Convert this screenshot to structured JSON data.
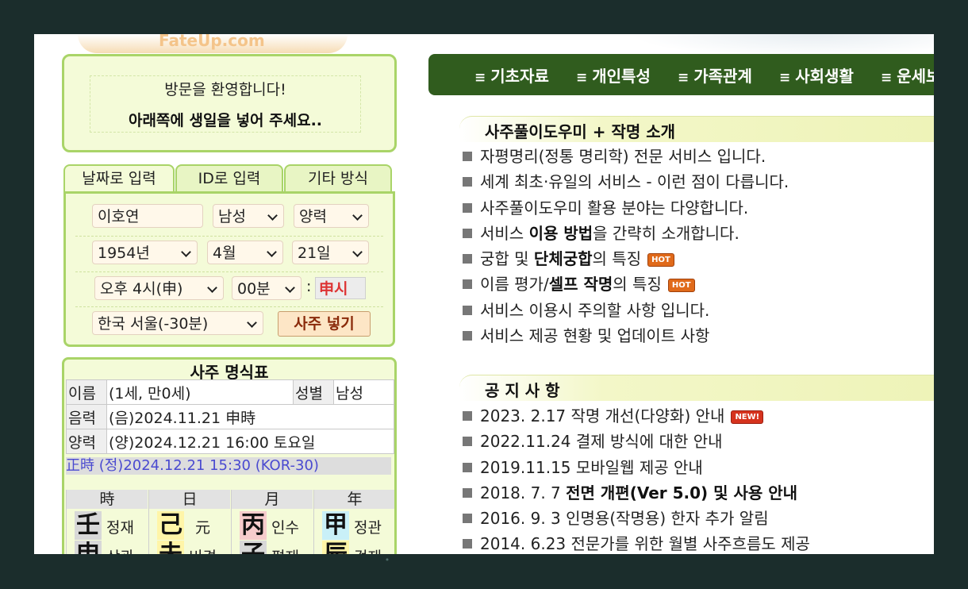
{
  "logo": {
    "text": "FateUp.com"
  },
  "welcome": {
    "line1": "방문을 환영합니다!",
    "line2": "아래쪽에 생일을 넣어 주세요.."
  },
  "tabs": [
    {
      "label": "날짜로 입력",
      "active": true
    },
    {
      "label": "ID로 입력",
      "active": false
    },
    {
      "label": "기타 방식",
      "active": false
    }
  ],
  "form": {
    "name": "이호연",
    "gender": "남성",
    "calendar": "양력",
    "year": "1954년",
    "month": "4월",
    "day": "21일",
    "hour": "오후 4시(申)",
    "minute": "00분",
    "colon": ":",
    "sisi": "申시",
    "region": "한국 서울(-30분)",
    "submit_label": "사주 넣기"
  },
  "saju": {
    "title": "사주 명식표",
    "name_label": "이름",
    "name_value": "(1세, 만0세)",
    "gender_label": "성별",
    "gender_value": "남성",
    "lunar_label": "음력",
    "lunar_value": "(음)2024.11.21 申時",
    "solar_label": "양력",
    "solar_value": "(양)2024.12.21 16:00 토요일",
    "true_time": "正時 (정)2024.12.21 15:30 (KOR-30)",
    "pillars": [
      {
        "head": "時",
        "stem": "壬",
        "stem_label": "정재",
        "branch": "申",
        "branch_label": "상관",
        "stem_color": "#d8d8d8",
        "branch_color": "#d8d8d8"
      },
      {
        "head": "日",
        "stem": "己",
        "stem_label": "元",
        "branch": "未",
        "branch_label": "비견",
        "stem_color": "#fff5a8",
        "branch_color": "#fff5a8"
      },
      {
        "head": "月",
        "stem": "丙",
        "stem_label": "인수",
        "branch": "子",
        "branch_label": "편재",
        "stem_color": "#f7cccc",
        "branch_color": "#d8d8d8"
      },
      {
        "head": "年",
        "stem": "甲",
        "stem_label": "정관",
        "branch": "辰",
        "branch_label": "겁재",
        "stem_color": "#c9f0f8",
        "branch_color": "#fff5a8"
      }
    ]
  },
  "nav": {
    "items": [
      "기초자료",
      "개인특성",
      "가족관계",
      "사회생활",
      "운세보기"
    ]
  },
  "intro": {
    "title": "사주풀이도우미 + 작명 소개",
    "items": [
      {
        "pre": "자평명리(정통 명리학) 전문 서비스 입니다.",
        "bold": "",
        "post": "",
        "badge": ""
      },
      {
        "pre": "세계 최초·유일의 서비스 - 이런 점이 다릅니다.",
        "bold": "",
        "post": "",
        "badge": ""
      },
      {
        "pre": "사주풀이도우미 활용 분야는 다양합니다.",
        "bold": "",
        "post": "",
        "badge": ""
      },
      {
        "pre": "서비스 ",
        "bold": "이용 방법",
        "post": "을 간략히 소개합니다.",
        "badge": ""
      },
      {
        "pre": "궁합 및 ",
        "bold": "단체궁합",
        "post": "의 특징",
        "badge": "HOT"
      },
      {
        "pre": "이름 평가/",
        "bold": "셀프 작명",
        "post": "의 특징",
        "badge": "HOT"
      },
      {
        "pre": "서비스 이용시 주의할 사항 입니다.",
        "bold": "",
        "post": "",
        "badge": ""
      },
      {
        "pre": "서비스 제공 현황 및 업데이트 사항",
        "bold": "",
        "post": "",
        "badge": ""
      }
    ]
  },
  "notice": {
    "title": "공 지 사 항",
    "items": [
      {
        "pre": "2023. 2.17 작명 개선(다양화) 안내",
        "bold": "",
        "badge": "NEW!"
      },
      {
        "pre": "2022.11.24 결제 방식에 대한 안내",
        "bold": "",
        "badge": ""
      },
      {
        "pre": "2019.11.15 모바일웹 제공 안내",
        "bold": "",
        "badge": ""
      },
      {
        "pre": "2018. 7. 7 ",
        "bold": "전면 개편(Ver 5.0) 및 사용 안내",
        "badge": ""
      },
      {
        "pre": "2016. 9. 3 인명용(작명용) 한자 추가 알림",
        "bold": "",
        "badge": ""
      },
      {
        "pre": "2014. 6.23 전문가를 위한 월별 사주흐름도 제공",
        "bold": "",
        "badge": ""
      }
    ]
  },
  "colors": {
    "nav_bg": "#305c1e",
    "panel_border": "#a9d468",
    "panel_bg": "#f4fbd8"
  }
}
